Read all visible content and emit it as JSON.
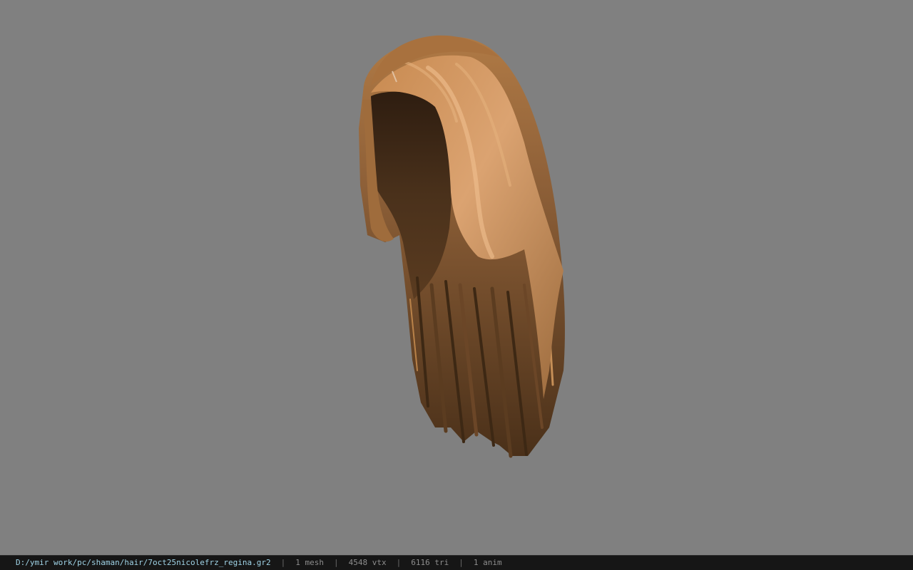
{
  "viewer": {
    "background_color": "#808080"
  },
  "model": {
    "icon": "hair-mesh-render",
    "colors": {
      "highlight": "#d9a06c",
      "mid": "#9a6a3e",
      "shadow": "#3a2616"
    }
  },
  "status_bar": {
    "file_path": "D:/ymir work/pc/shaman/hair/7oct25nicolefrz_regina.gr2",
    "separator": "|",
    "mesh_count": "1 mesh",
    "vertex_count": "4548 vtx",
    "triangle_count": "6116 tri",
    "anim_count": "1 anim",
    "colors": {
      "path": "#9fd3e6",
      "text": "#8d8d8d",
      "background": "#161616"
    }
  }
}
